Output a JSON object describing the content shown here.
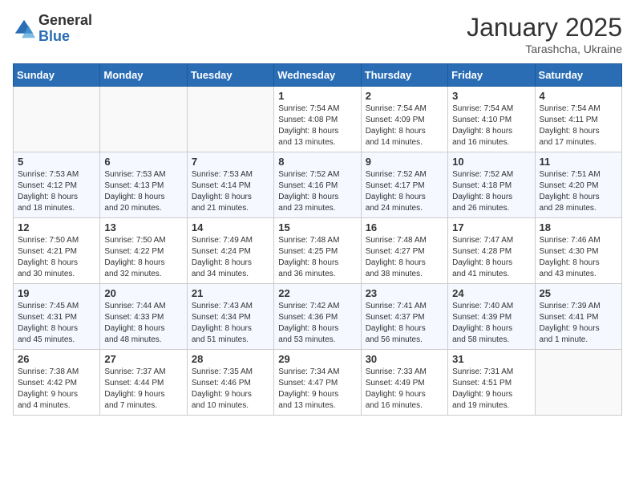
{
  "header": {
    "logo": {
      "general": "General",
      "blue": "Blue"
    },
    "month": "January 2025",
    "location": "Tarashcha, Ukraine"
  },
  "weekdays": [
    "Sunday",
    "Monday",
    "Tuesday",
    "Wednesday",
    "Thursday",
    "Friday",
    "Saturday"
  ],
  "weeks": [
    [
      {
        "day": "",
        "info": ""
      },
      {
        "day": "",
        "info": ""
      },
      {
        "day": "",
        "info": ""
      },
      {
        "day": "1",
        "info": "Sunrise: 7:54 AM\nSunset: 4:08 PM\nDaylight: 8 hours\nand 13 minutes."
      },
      {
        "day": "2",
        "info": "Sunrise: 7:54 AM\nSunset: 4:09 PM\nDaylight: 8 hours\nand 14 minutes."
      },
      {
        "day": "3",
        "info": "Sunrise: 7:54 AM\nSunset: 4:10 PM\nDaylight: 8 hours\nand 16 minutes."
      },
      {
        "day": "4",
        "info": "Sunrise: 7:54 AM\nSunset: 4:11 PM\nDaylight: 8 hours\nand 17 minutes."
      }
    ],
    [
      {
        "day": "5",
        "info": "Sunrise: 7:53 AM\nSunset: 4:12 PM\nDaylight: 8 hours\nand 18 minutes."
      },
      {
        "day": "6",
        "info": "Sunrise: 7:53 AM\nSunset: 4:13 PM\nDaylight: 8 hours\nand 20 minutes."
      },
      {
        "day": "7",
        "info": "Sunrise: 7:53 AM\nSunset: 4:14 PM\nDaylight: 8 hours\nand 21 minutes."
      },
      {
        "day": "8",
        "info": "Sunrise: 7:52 AM\nSunset: 4:16 PM\nDaylight: 8 hours\nand 23 minutes."
      },
      {
        "day": "9",
        "info": "Sunrise: 7:52 AM\nSunset: 4:17 PM\nDaylight: 8 hours\nand 24 minutes."
      },
      {
        "day": "10",
        "info": "Sunrise: 7:52 AM\nSunset: 4:18 PM\nDaylight: 8 hours\nand 26 minutes."
      },
      {
        "day": "11",
        "info": "Sunrise: 7:51 AM\nSunset: 4:20 PM\nDaylight: 8 hours\nand 28 minutes."
      }
    ],
    [
      {
        "day": "12",
        "info": "Sunrise: 7:50 AM\nSunset: 4:21 PM\nDaylight: 8 hours\nand 30 minutes."
      },
      {
        "day": "13",
        "info": "Sunrise: 7:50 AM\nSunset: 4:22 PM\nDaylight: 8 hours\nand 32 minutes."
      },
      {
        "day": "14",
        "info": "Sunrise: 7:49 AM\nSunset: 4:24 PM\nDaylight: 8 hours\nand 34 minutes."
      },
      {
        "day": "15",
        "info": "Sunrise: 7:48 AM\nSunset: 4:25 PM\nDaylight: 8 hours\nand 36 minutes."
      },
      {
        "day": "16",
        "info": "Sunrise: 7:48 AM\nSunset: 4:27 PM\nDaylight: 8 hours\nand 38 minutes."
      },
      {
        "day": "17",
        "info": "Sunrise: 7:47 AM\nSunset: 4:28 PM\nDaylight: 8 hours\nand 41 minutes."
      },
      {
        "day": "18",
        "info": "Sunrise: 7:46 AM\nSunset: 4:30 PM\nDaylight: 8 hours\nand 43 minutes."
      }
    ],
    [
      {
        "day": "19",
        "info": "Sunrise: 7:45 AM\nSunset: 4:31 PM\nDaylight: 8 hours\nand 45 minutes."
      },
      {
        "day": "20",
        "info": "Sunrise: 7:44 AM\nSunset: 4:33 PM\nDaylight: 8 hours\nand 48 minutes."
      },
      {
        "day": "21",
        "info": "Sunrise: 7:43 AM\nSunset: 4:34 PM\nDaylight: 8 hours\nand 51 minutes."
      },
      {
        "day": "22",
        "info": "Sunrise: 7:42 AM\nSunset: 4:36 PM\nDaylight: 8 hours\nand 53 minutes."
      },
      {
        "day": "23",
        "info": "Sunrise: 7:41 AM\nSunset: 4:37 PM\nDaylight: 8 hours\nand 56 minutes."
      },
      {
        "day": "24",
        "info": "Sunrise: 7:40 AM\nSunset: 4:39 PM\nDaylight: 8 hours\nand 58 minutes."
      },
      {
        "day": "25",
        "info": "Sunrise: 7:39 AM\nSunset: 4:41 PM\nDaylight: 9 hours\nand 1 minute."
      }
    ],
    [
      {
        "day": "26",
        "info": "Sunrise: 7:38 AM\nSunset: 4:42 PM\nDaylight: 9 hours\nand 4 minutes."
      },
      {
        "day": "27",
        "info": "Sunrise: 7:37 AM\nSunset: 4:44 PM\nDaylight: 9 hours\nand 7 minutes."
      },
      {
        "day": "28",
        "info": "Sunrise: 7:35 AM\nSunset: 4:46 PM\nDaylight: 9 hours\nand 10 minutes."
      },
      {
        "day": "29",
        "info": "Sunrise: 7:34 AM\nSunset: 4:47 PM\nDaylight: 9 hours\nand 13 minutes."
      },
      {
        "day": "30",
        "info": "Sunrise: 7:33 AM\nSunset: 4:49 PM\nDaylight: 9 hours\nand 16 minutes."
      },
      {
        "day": "31",
        "info": "Sunrise: 7:31 AM\nSunset: 4:51 PM\nDaylight: 9 hours\nand 19 minutes."
      },
      {
        "day": "",
        "info": ""
      }
    ]
  ]
}
